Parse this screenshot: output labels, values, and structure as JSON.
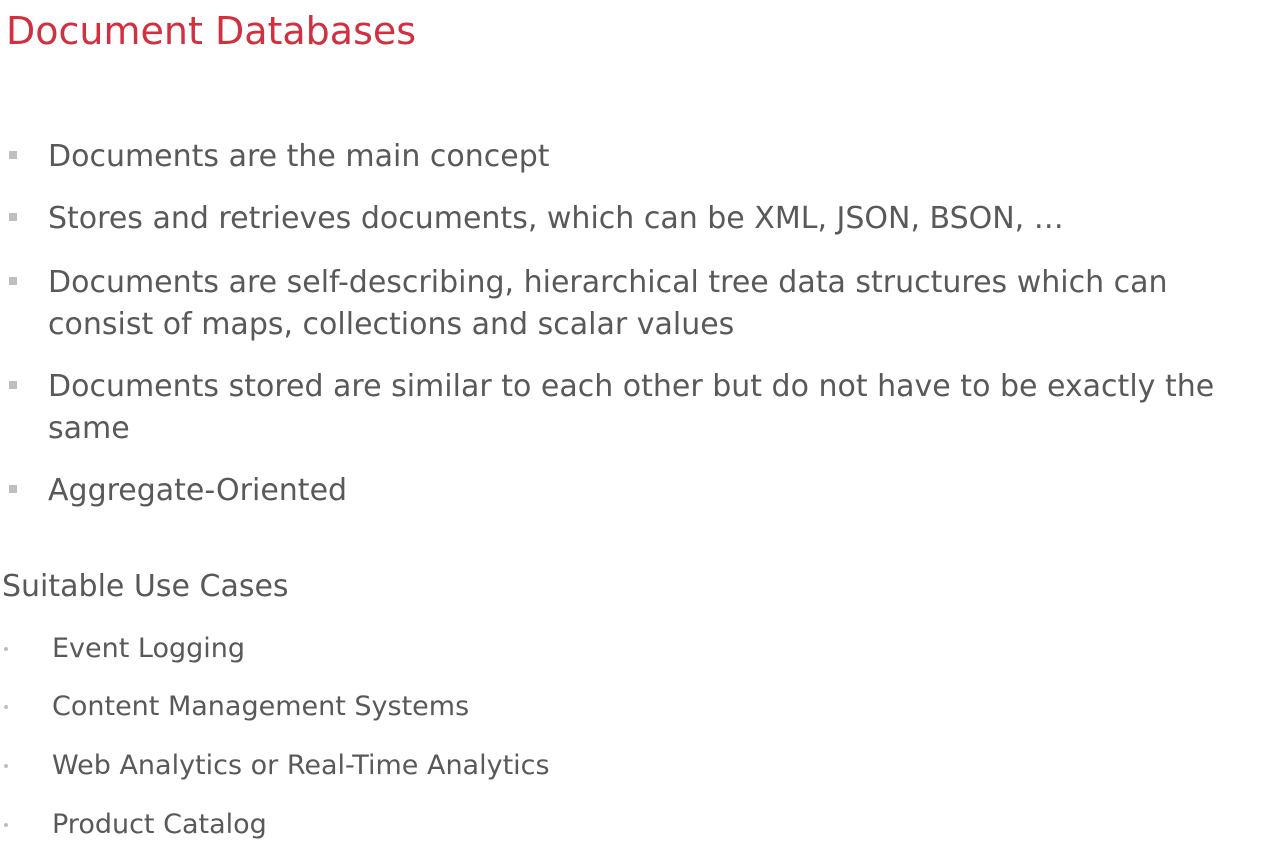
{
  "slide": {
    "title": "Document Databases"
  },
  "bullets": [
    {
      "text": "Documents are the main concept"
    },
    {
      "text": "Stores and retrieves documents, which can be XML, JSON, BSON, …"
    },
    {
      "text": "Documents are self-describing, hierarchical tree data structures which can consist of maps, collections and scalar values"
    },
    {
      "text": "Documents stored are similar to each other but do not have to be exactly the same"
    },
    {
      "text": "Aggregate-Oriented"
    }
  ],
  "use_cases": {
    "heading": "Suitable Use Cases",
    "items": [
      {
        "text": "Event Logging"
      },
      {
        "text": "Content Management Systems"
      },
      {
        "text": "Web Analytics or Real-Time Analytics"
      },
      {
        "text": "Product Catalog"
      }
    ]
  }
}
